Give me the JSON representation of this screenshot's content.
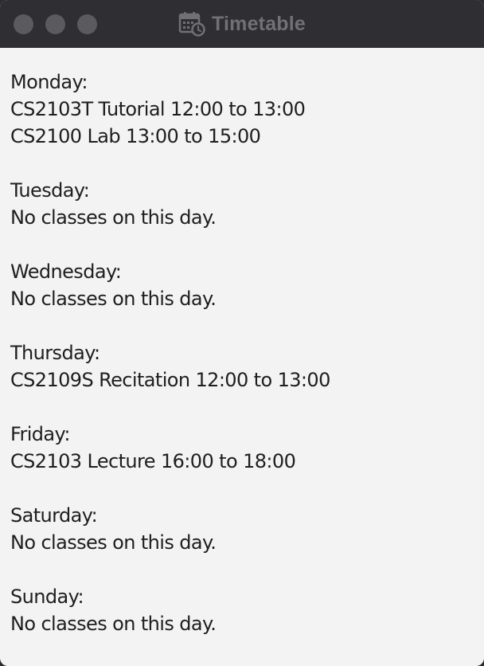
{
  "window": {
    "title": "Timetable",
    "title_icon": "calendar-clock-icon",
    "controls": [
      "close",
      "minimize",
      "maximize"
    ]
  },
  "timetable": {
    "days": [
      {
        "day": "Monday:",
        "lines": [
          "CS2103T Tutorial 12:00 to 13:00",
          "CS2100 Lab 13:00 to 15:00"
        ]
      },
      {
        "day": "Tuesday:",
        "lines": [
          "No classes on this day."
        ]
      },
      {
        "day": "Wednesday:",
        "lines": [
          "No classes on this day."
        ]
      },
      {
        "day": "Thursday:",
        "lines": [
          "CS2109S Recitation 12:00 to 13:00"
        ]
      },
      {
        "day": "Friday:",
        "lines": [
          "CS2103 Lecture 16:00 to 18:00"
        ]
      },
      {
        "day": "Saturday:",
        "lines": [
          "No classes on this day."
        ]
      },
      {
        "day": "Sunday:",
        "lines": [
          "No classes on this day."
        ]
      }
    ]
  },
  "colors": {
    "titlebar": "#2f2f33",
    "content_bg": "#f3f3f3",
    "text": "#1e1e1e",
    "title_text": "#707075"
  }
}
